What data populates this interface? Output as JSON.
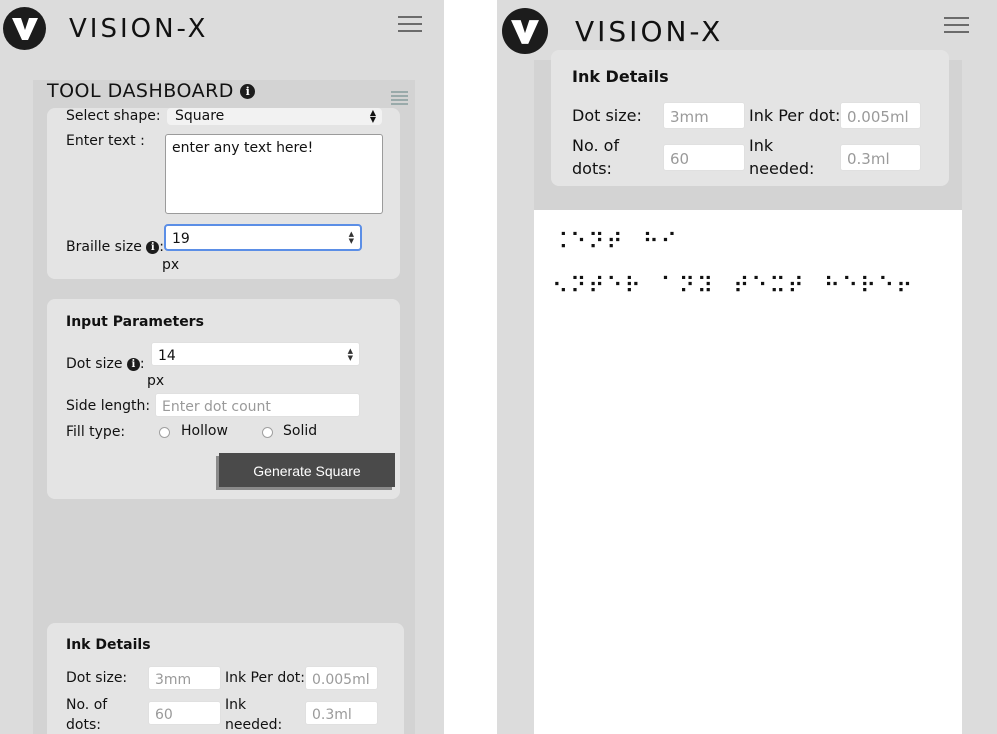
{
  "app": {
    "brand": "VISION-X",
    "logo_letter": "V"
  },
  "dashboard": {
    "title": "TOOL DASHBOARD",
    "select_shape_label": "Select shape:",
    "shape_value": "Square",
    "enter_text_label": "Enter text :",
    "text_value": "enter any text here!",
    "braille_size_label": "Braille size",
    "braille_size_value": "19",
    "braille_unit": "px"
  },
  "input_params": {
    "title": "Input Parameters",
    "dot_size_label": "Dot size",
    "dot_size_value": "14",
    "dot_unit": "px",
    "side_length_label": "Side length:",
    "side_length_placeholder": "Enter dot count",
    "fill_type_label": "Fill type:",
    "fill_options": [
      "Hollow",
      "Solid"
    ],
    "generate_label": "Generate Square"
  },
  "ink_details": {
    "title": "Ink Details",
    "dot_size_label": "Dot size:",
    "dot_size_value": "3mm",
    "ink_per_dot_label": "Ink Per dot:",
    "ink_per_dot_value": "0.005ml",
    "no_of_dots_label_1": "No. of",
    "no_of_dots_label_2": "dots:",
    "no_of_dots_value": "60",
    "ink_needed_label_1": "Ink",
    "ink_needed_label_2": "needed:",
    "ink_needed_value": "0.3ml"
  },
  "output": {
    "braille_line_1": "⠨⠑⠝⠞⠀⠓⠊",
    "braille_line_2": "⠢⠝⠞⠑⠗⠀⠁⠝⠽⠀⠞⠑⠭⠞⠀⠓⠑⠗⠑⠖"
  },
  "colors": {
    "logo_bg": "#1c1c1c",
    "button_bg": "#4a4a4a",
    "focus_border": "#5b8ee6",
    "panel_bg": "#dcdcdc"
  },
  "icons": [
    "logo-icon",
    "hamburger-menu-icon",
    "info-icon",
    "list-icon",
    "radio-icon"
  ]
}
